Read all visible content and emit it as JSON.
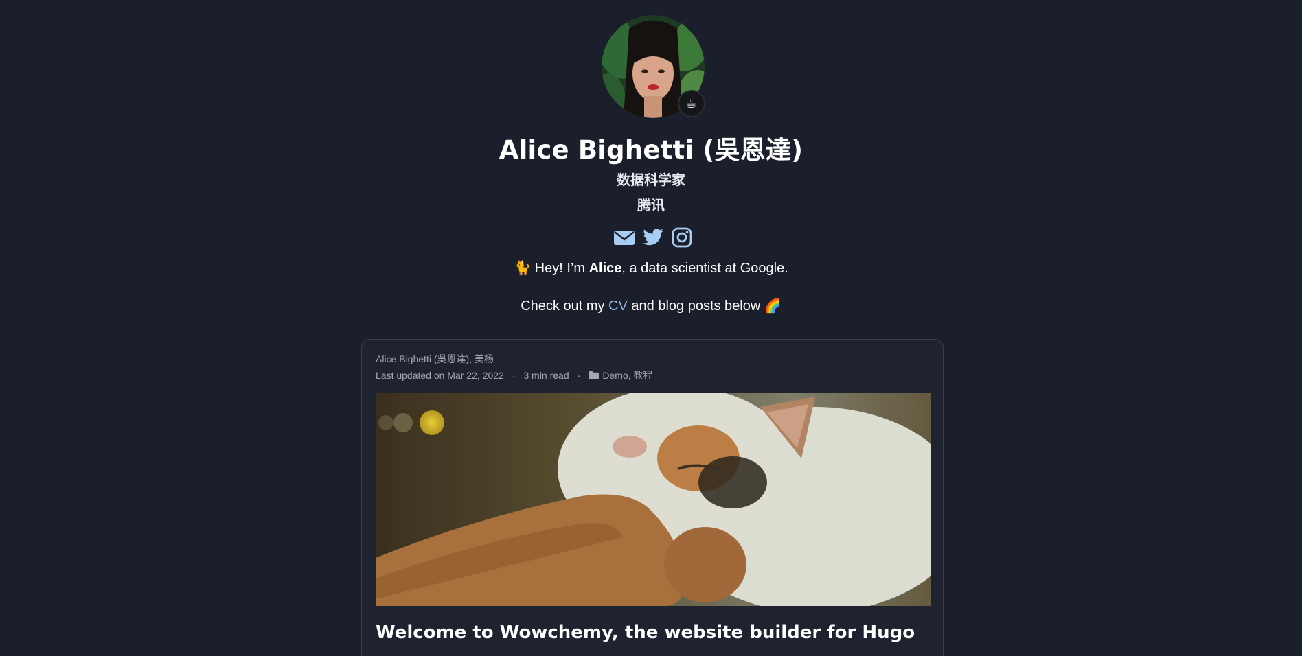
{
  "profile": {
    "name": "Alice Bighetti (吳恩達)",
    "role": "数据科学家",
    "organization": "腾讯",
    "status_emoji": "☕",
    "socials": [
      {
        "icon": "envelope-icon",
        "color": "#a7cdf2"
      },
      {
        "icon": "twitter-icon",
        "color": "#a7cdf2"
      },
      {
        "icon": "instagram-icon",
        "color": "#a7cdf2"
      }
    ]
  },
  "bio": {
    "line1_emoji": "🐈",
    "line1_prefix": " Hey! I’m ",
    "line1_name": "Alice",
    "line1_suffix": ", a data scientist at Google.",
    "line2_prefix": "Check out my ",
    "line2_link": "CV",
    "line2_suffix": " and blog posts below 🌈"
  },
  "post": {
    "authors": "Alice Bighetti (吳恩達), 美杨",
    "updated": "Last updated on Mar 22, 2022",
    "separator": "·",
    "read_time": "3 min read",
    "categories": "Demo, 教程",
    "title": "Welcome to Wowchemy, the website builder for Hugo"
  },
  "colors": {
    "background": "#1b1f2b",
    "card": "#1f2330",
    "link": "#8fb8ea",
    "icon": "#a7cdf2"
  }
}
